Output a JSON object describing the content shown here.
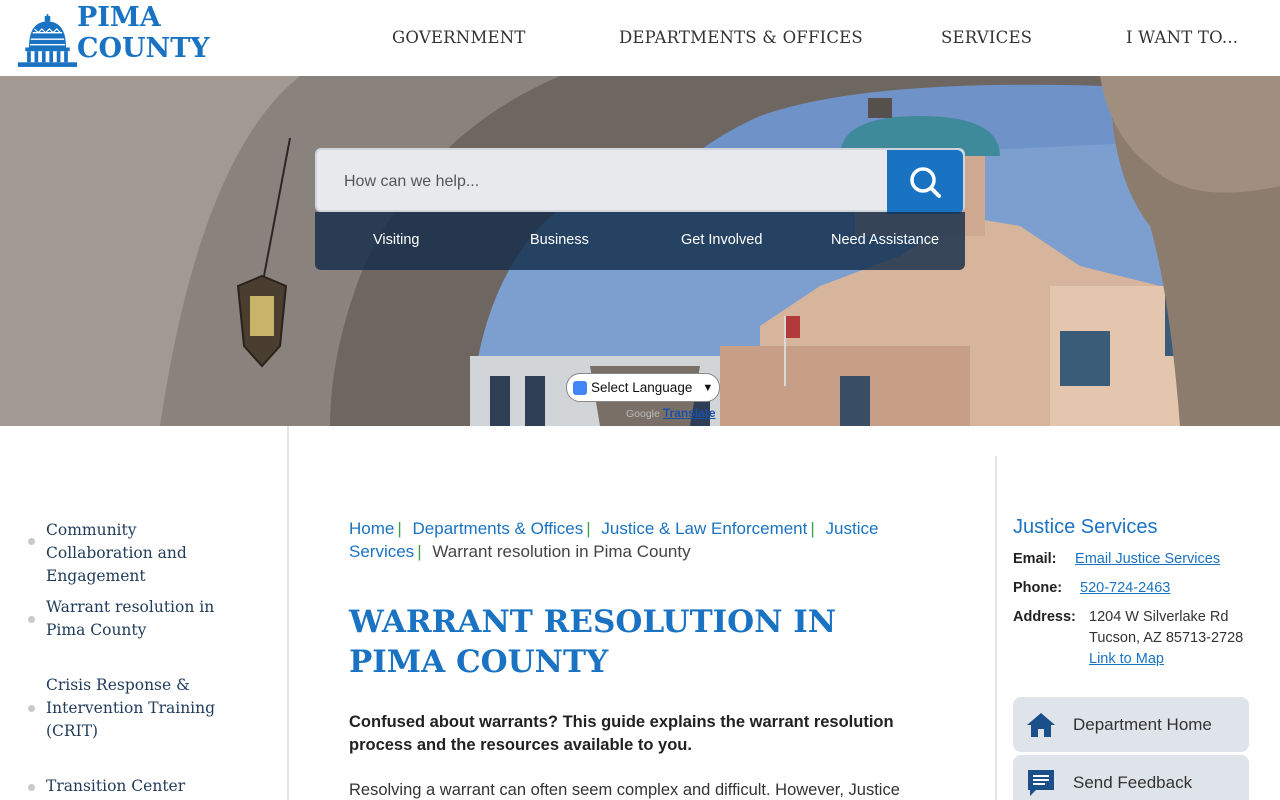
{
  "header": {
    "logo_text": "PIMA COUNTY",
    "nav": [
      "GOVERNMENT",
      "DEPARTMENTS & OFFICES",
      "SERVICES",
      "I WANT TO..."
    ]
  },
  "hero": {
    "search_placeholder": "How can we help...",
    "quick_links": [
      "Visiting",
      "Business",
      "Get Involved",
      "Need Assistance"
    ],
    "language_select": "Select Language",
    "powered_by": "Google",
    "translate_label": "Translate"
  },
  "sidebar": {
    "items": [
      "Community Collaboration and Engagement",
      "Warrant resolution in Pima County",
      "Crisis Response & Intervention Training (CRIT)",
      "Transition Center"
    ]
  },
  "breadcrumb": {
    "links": [
      "Home",
      "Departments & Offices",
      "Justice & Law Enforcement",
      "Justice Services"
    ],
    "current": "Warrant resolution in Pima County"
  },
  "main": {
    "title": "WARRANT RESOLUTION IN PIMA COUNTY",
    "lead": "Confused about warrants? This guide explains the warrant resolution process and the resources available to you.",
    "body": "Resolving a warrant can often seem complex and difficult. However, Justice"
  },
  "contact": {
    "heading": "Justice Services",
    "email_label": "Email:",
    "email_link": "Email Justice Services",
    "phone_label": "Phone:",
    "phone": "520-724-2463",
    "address_label": "Address:",
    "address_line1": "1204 W Silverlake Rd",
    "address_line2": "Tucson, AZ 85713-2728",
    "map_link": "Link to Map",
    "buttons": [
      "Department Home",
      "Send Feedback"
    ]
  },
  "colors": {
    "brand_blue": "#1a73c2",
    "quick_links_bg": "#142d4b",
    "breadcrumb_separator": "#3aa34a"
  }
}
